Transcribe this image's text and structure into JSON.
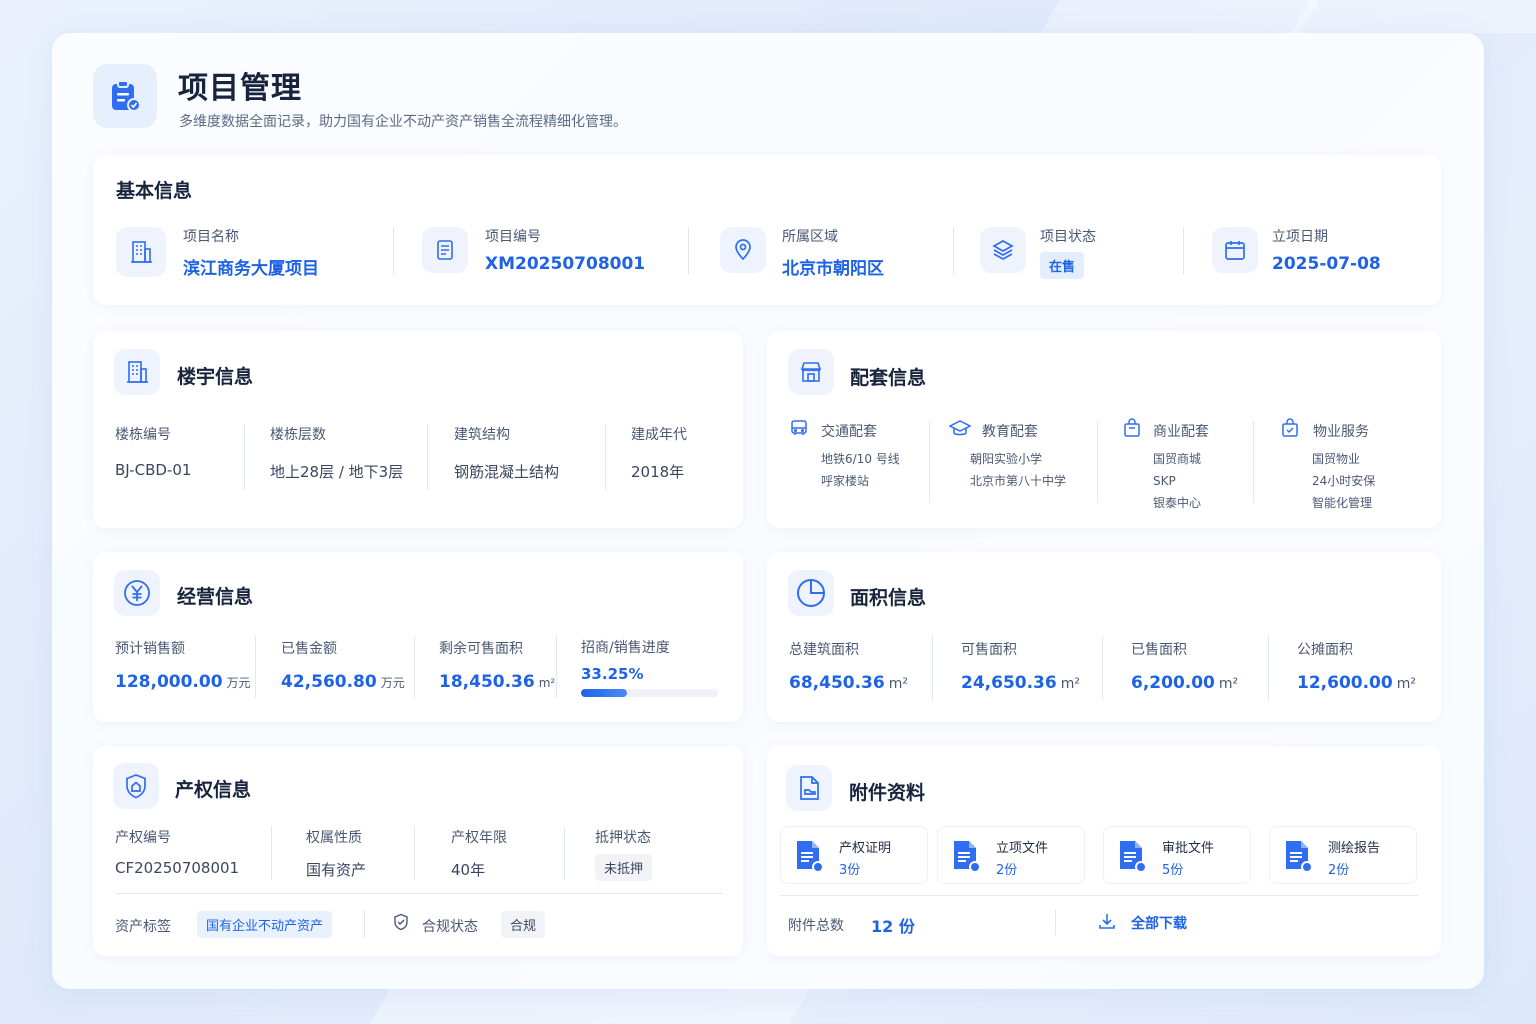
{
  "header": {
    "title": "项目管理",
    "subtitle": "多维度数据全面记录，助力国有企业不动产资产销售全流程精细化管理。"
  },
  "basic": {
    "title": "基本信息",
    "name_label": "项目名称",
    "name_value": "滨江商务大厦项目",
    "code_label": "项目编号",
    "code_value": "XM20250708001",
    "area_label": "所属区域",
    "area_value": "北京市朝阳区",
    "status_label": "项目状态",
    "status_value": "在售",
    "date_label": "立项日期",
    "date_value": "2025-07-08"
  },
  "building": {
    "title": "楼宇信息",
    "cols": [
      {
        "label": "楼栋编号",
        "value": "BJ-CBD-01"
      },
      {
        "label": "楼栋层数",
        "value": "地上28层 / 地下3层"
      },
      {
        "label": "建筑结构",
        "value": "钢筋混凝土结构"
      },
      {
        "label": "建成年代",
        "value": "2018年"
      }
    ]
  },
  "facilities": {
    "title": "配套信息",
    "groups": [
      {
        "label": "交通配套",
        "items": [
          "地铁6/10 号线",
          "呼家楼站"
        ]
      },
      {
        "label": "教育配套",
        "items": [
          "朝阳实验小学",
          "北京市第八十中学"
        ]
      },
      {
        "label": "商业配套",
        "items": [
          "国贸商城",
          "SKP",
          "银泰中心"
        ]
      },
      {
        "label": "物业服务",
        "items": [
          "国贸物业",
          "24小时安保",
          "智能化管理"
        ]
      }
    ]
  },
  "operation": {
    "title": "经营信息",
    "expected_label": "预计销售额",
    "expected_value": "128,000.00",
    "expected_unit": "万元",
    "sold_label": "已售金额",
    "sold_value": "42,560.80",
    "sold_unit": "万元",
    "remaining_label": "剩余可售面积",
    "remaining_value": "18,450.36",
    "remaining_unit": "m²",
    "progress_label": "招商/销售进度",
    "progress_text": "33.25%",
    "progress_value": 0.3325
  },
  "area": {
    "title": "面积信息",
    "cols": [
      {
        "label": "总建筑面积",
        "value": "68,450.36",
        "unit": "m²"
      },
      {
        "label": "可售面积",
        "value": "24,650.36",
        "unit": "m²"
      },
      {
        "label": "已售面积",
        "value": "6,200.00",
        "unit": "m²"
      },
      {
        "label": "公摊面积",
        "value": "12,600.00",
        "unit": "m²"
      }
    ]
  },
  "property": {
    "title": "产权信息",
    "code_label": "产权编号",
    "code_value": "CF20250708001",
    "nature_label": "权属性质",
    "nature_value": "国有资产",
    "term_label": "产权年限",
    "term_value": "40年",
    "mortgage_label": "抵押状态",
    "mortgage_value": "未抵押",
    "tag_label": "资产标签",
    "tag_value": "国有企业不动产资产",
    "compliance_label": "合规状态",
    "compliance_value": "合规"
  },
  "attachments": {
    "title": "附件资料",
    "items": [
      {
        "name": "产权证明",
        "count": "3份"
      },
      {
        "name": "立项文件",
        "count": "2份"
      },
      {
        "name": "审批文件",
        "count": "5份"
      },
      {
        "name": "测绘报告",
        "count": "2份"
      }
    ],
    "total_label": "附件总数",
    "total_value": "12 份",
    "download_label": "全部下载"
  },
  "colors": {
    "accent": "#1e63e6",
    "icon_bg": "#eef3fd",
    "tag_bg": "#e6effd"
  }
}
